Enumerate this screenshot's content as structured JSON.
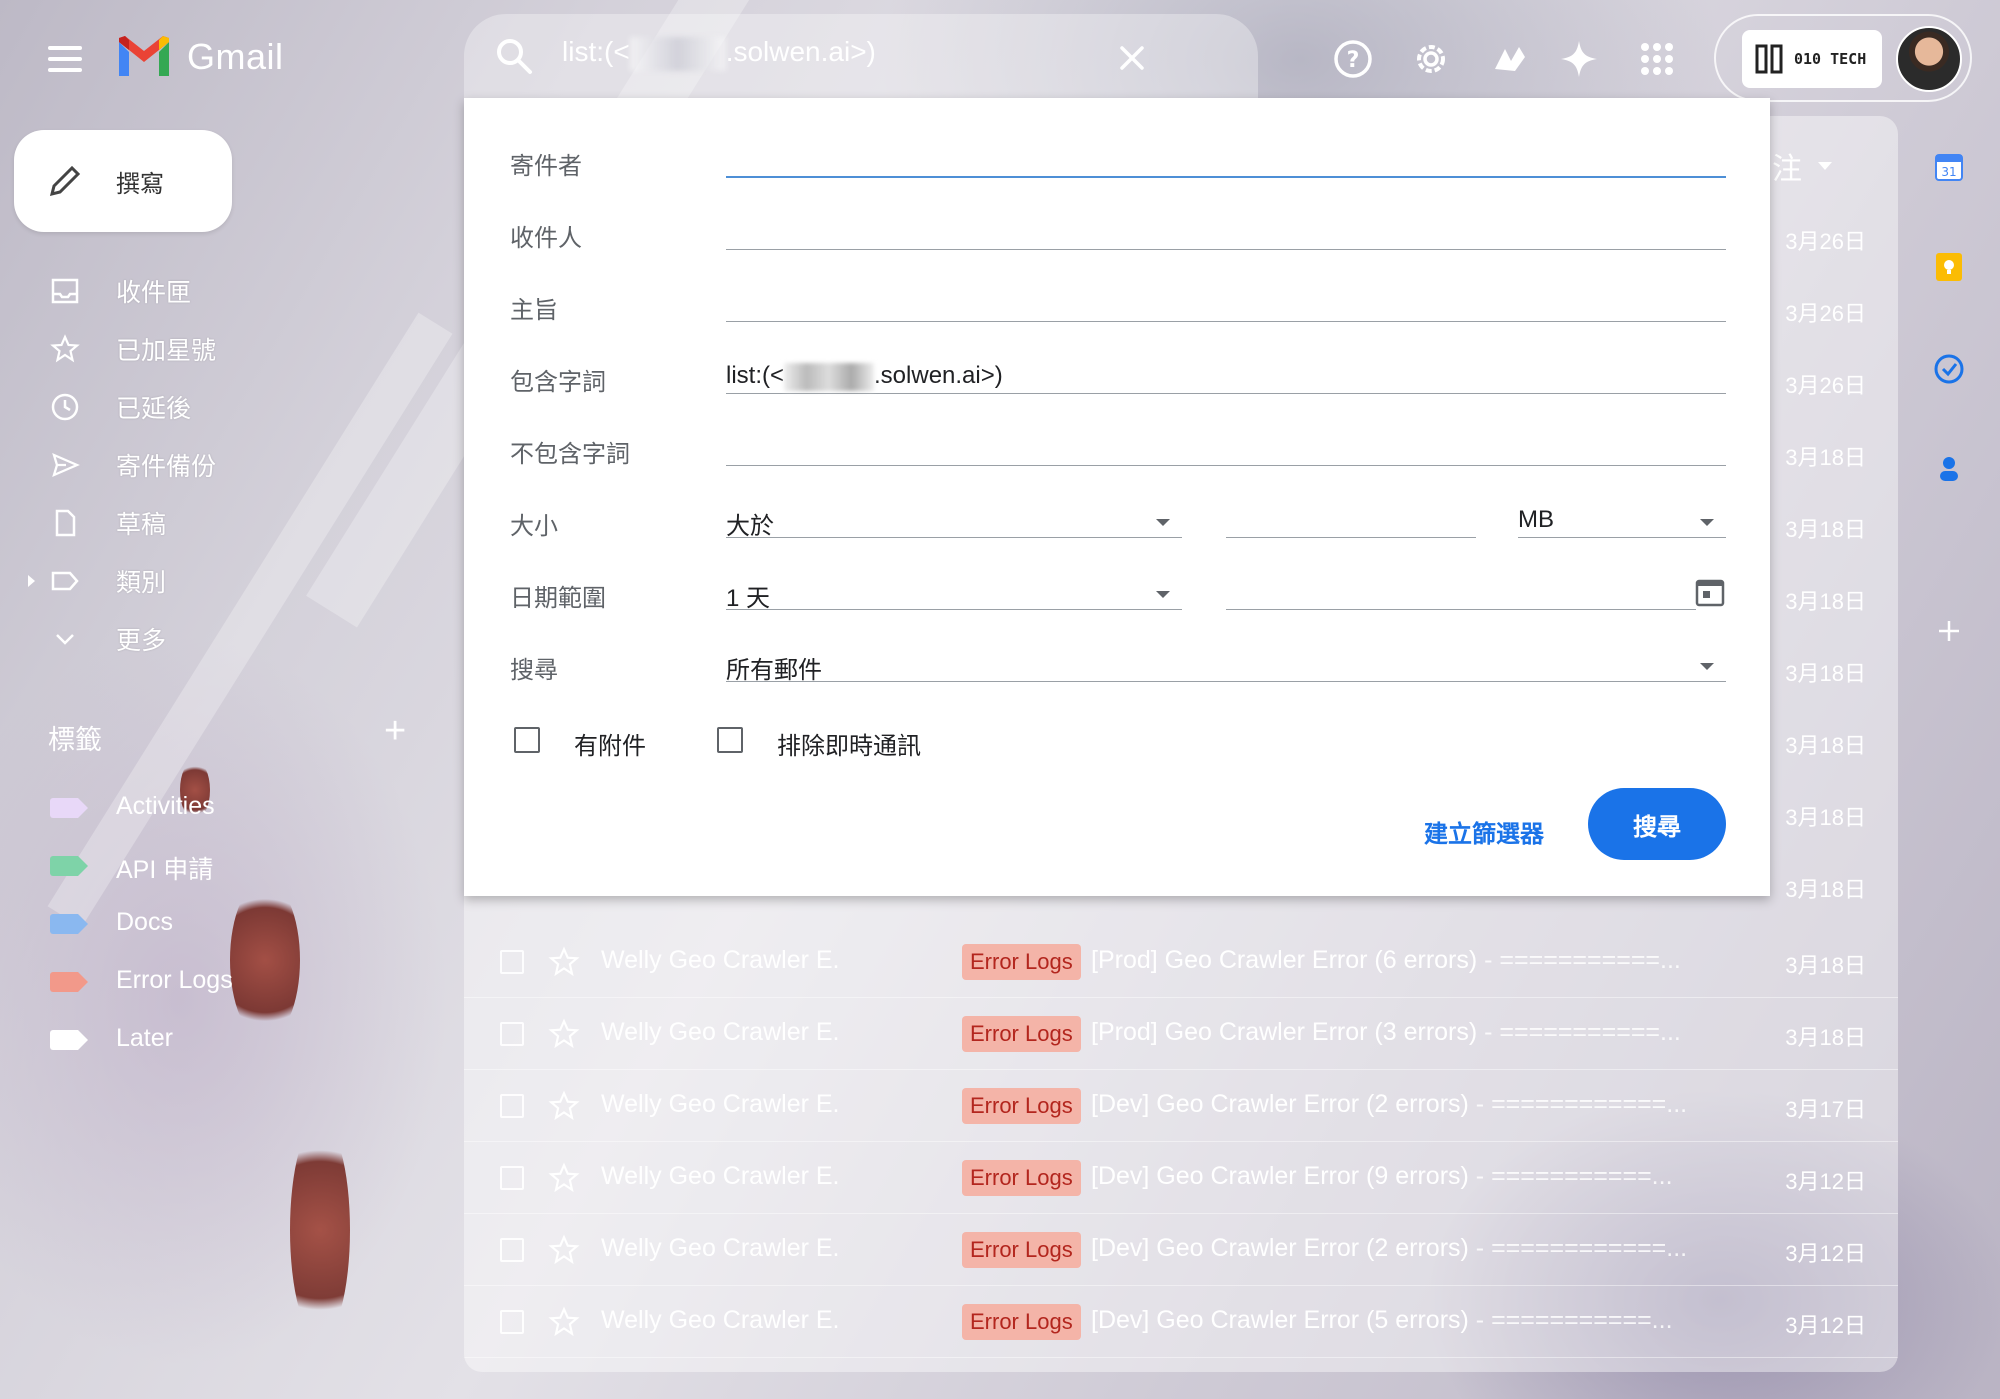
{
  "app": {
    "name": "Gmail"
  },
  "search": {
    "query_prefix": "list:(<",
    "query_suffix": ".solwen.ai>)"
  },
  "compose": {
    "label": "撰寫"
  },
  "nav": {
    "items": [
      {
        "label": "收件匣",
        "icon": "inbox-icon"
      },
      {
        "label": "已加星號",
        "icon": "star-icon"
      },
      {
        "label": "已延後",
        "icon": "clock-icon"
      },
      {
        "label": "寄件備份",
        "icon": "send-icon"
      },
      {
        "label": "草稿",
        "icon": "draft-icon"
      },
      {
        "label": "類別",
        "icon": "label-icon"
      },
      {
        "label": "更多",
        "icon": "chevron-down-icon"
      }
    ]
  },
  "labels": {
    "heading": "標籤",
    "items": [
      {
        "name": "Activities",
        "color": "#e8d8f8"
      },
      {
        "name": "API 申請",
        "color": "#7ed3a8"
      },
      {
        "name": "Docs",
        "color": "#8ab8f0"
      },
      {
        "name": "Error Logs",
        "color": "#f2998a"
      },
      {
        "name": "Later",
        "color": "#ffffff"
      }
    ]
  },
  "list": {
    "header_right": "注",
    "dates_above": [
      "3月26日",
      "3月26日",
      "3月26日",
      "3月18日",
      "3月18日",
      "3月18日",
      "3月18日",
      "3月18日",
      "3月18日",
      "3月18日"
    ],
    "rows": [
      {
        "sender": "Welly Geo Crawler E.",
        "tag": "Error Logs",
        "subject": "[Prod] Geo Crawler Error (6 errors)",
        "snippet": " - ===========...",
        "date": "3月18日"
      },
      {
        "sender": "Welly Geo Crawler E.",
        "tag": "Error Logs",
        "subject": "[Prod] Geo Crawler Error (3 errors)",
        "snippet": " - ===========...",
        "date": "3月18日"
      },
      {
        "sender": "Welly Geo Crawler E.",
        "tag": "Error Logs",
        "subject": "[Dev] Geo Crawler Error (2 errors)",
        "snippet": " - ============...",
        "date": "3月17日"
      },
      {
        "sender": "Welly Geo Crawler E.",
        "tag": "Error Logs",
        "subject": "[Dev] Geo Crawler Error (9 errors)",
        "snippet": " - ===========...",
        "date": "3月12日"
      },
      {
        "sender": "Welly Geo Crawler E.",
        "tag": "Error Logs",
        "subject": "[Dev] Geo Crawler Error (2 errors)",
        "snippet": " - ============...",
        "date": "3月12日"
      },
      {
        "sender": "Welly Geo Crawler E.",
        "tag": "Error Logs",
        "subject": "[Dev] Geo Crawler Error (5 errors)",
        "snippet": " - ===========...",
        "date": "3月12日"
      }
    ]
  },
  "advanced": {
    "from_label": "寄件者",
    "to_label": "收件人",
    "subject_label": "主旨",
    "has_words_label": "包含字詞",
    "has_words_prefix": "list:(<",
    "has_words_suffix": ".solwen.ai>)",
    "not_words_label": "不包含字詞",
    "size_label": "大小",
    "size_op": "大於",
    "size_unit": "MB",
    "date_label": "日期範圍",
    "date_value": "1 天",
    "search_in_label": "搜尋",
    "search_in_value": "所有郵件",
    "has_attachment": "有附件",
    "exclude_chats": "排除即時通訊",
    "create_filter": "建立篩選器",
    "search_button": "搜尋"
  },
  "org": {
    "badge": "010 TECH"
  },
  "colors": {
    "primary": "#1a73e8",
    "tag_bg": "#f4b4a8",
    "tag_text": "#b3261e"
  }
}
